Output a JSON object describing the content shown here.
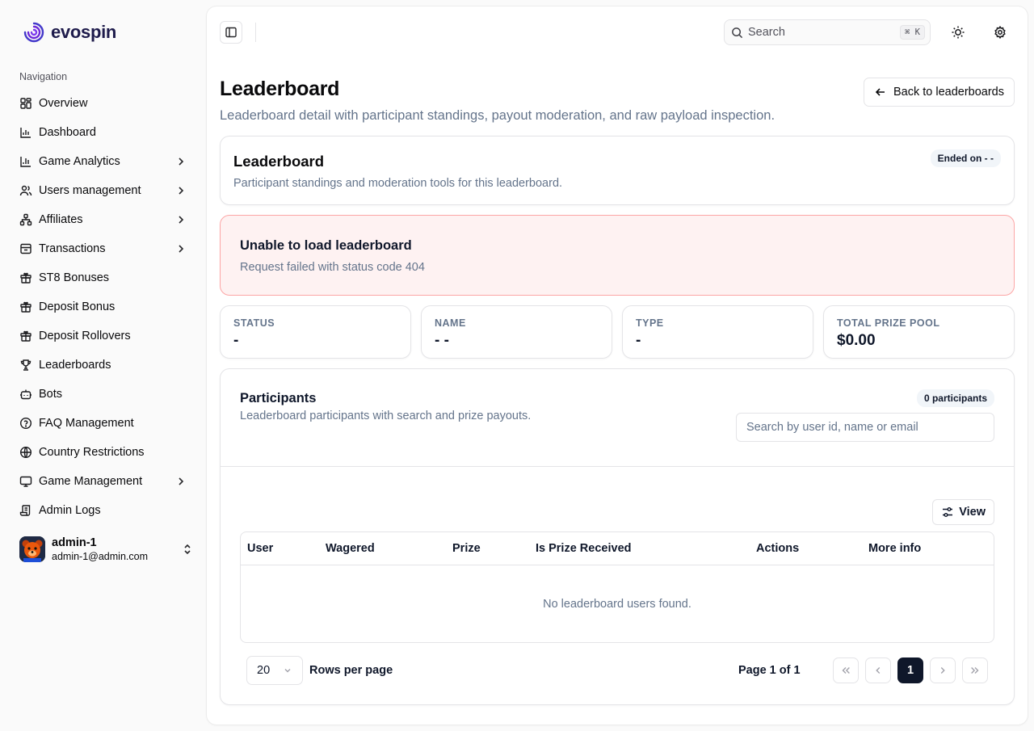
{
  "brand": {
    "name": "evospin"
  },
  "sidebar": {
    "heading": "Navigation",
    "items": [
      {
        "label": "Overview",
        "icon": "layout-grid-icon",
        "has_children": false
      },
      {
        "label": "Dashboard",
        "icon": "bar-chart-icon",
        "has_children": false
      },
      {
        "label": "Game Analytics",
        "icon": "bar-chart-icon",
        "has_children": true
      },
      {
        "label": "Users management",
        "icon": "users-icon",
        "has_children": true
      },
      {
        "label": "Affiliates",
        "icon": "network-icon",
        "has_children": true
      },
      {
        "label": "Transactions",
        "icon": "archive-icon",
        "has_children": true
      },
      {
        "label": "ST8 Bonuses",
        "icon": "gift-icon",
        "has_children": false
      },
      {
        "label": "Deposit Bonus",
        "icon": "gift-icon",
        "has_children": false
      },
      {
        "label": "Deposit Rollovers",
        "icon": "gift-icon",
        "has_children": false
      },
      {
        "label": "Leaderboards",
        "icon": "trophy-icon",
        "has_children": false
      },
      {
        "label": "Bots",
        "icon": "bot-icon",
        "has_children": false
      },
      {
        "label": "FAQ Management",
        "icon": "help-circle-icon",
        "has_children": false
      },
      {
        "label": "Country Restrictions",
        "icon": "globe-icon",
        "has_children": false
      },
      {
        "label": "Game Management",
        "icon": "monitor-icon",
        "has_children": true
      },
      {
        "label": "Admin Logs",
        "icon": "scroll-icon",
        "has_children": false
      }
    ],
    "user": {
      "name": "admin-1",
      "email": "admin-1@admin.com"
    }
  },
  "topbar": {
    "search_placeholder": "Search",
    "search_shortcut": "⌘ K"
  },
  "page": {
    "title": "Leaderboard",
    "subtitle": "Leaderboard detail with participant standings, payout moderation, and raw payload inspection.",
    "back_label": "Back to leaderboards"
  },
  "leaderboard_card": {
    "title": "Leaderboard",
    "description": "Participant standings and moderation tools for this leaderboard.",
    "badge": "Ended on - -"
  },
  "error": {
    "title": "Unable to load leaderboard",
    "message": "Request failed with status code 404"
  },
  "stats": [
    {
      "label": "STATUS",
      "value": "-"
    },
    {
      "label": "NAME",
      "value": "- -"
    },
    {
      "label": "TYPE",
      "value": "-"
    },
    {
      "label": "TOTAL PRIZE POOL",
      "value": "$0.00"
    }
  ],
  "participants": {
    "title": "Participants",
    "description": "Leaderboard participants with search and prize payouts.",
    "badge": "0 participants",
    "search_placeholder": "Search by user id, name or email",
    "view_label": "View",
    "columns": [
      "User",
      "Wagered",
      "Prize",
      "Is Prize Received",
      "Actions",
      "More info"
    ],
    "empty_text": "No leaderboard users found.",
    "rows_per_page_value": "20",
    "rows_per_page_label": "Rows per page",
    "page_info": "Page 1 of 1",
    "current_page": "1"
  },
  "colors": {
    "accent": "#0f172a",
    "brand": "#4338ca",
    "error_bg": "#fef2f2",
    "error_border": "#fca5a5",
    "muted_text": "#64748b"
  }
}
